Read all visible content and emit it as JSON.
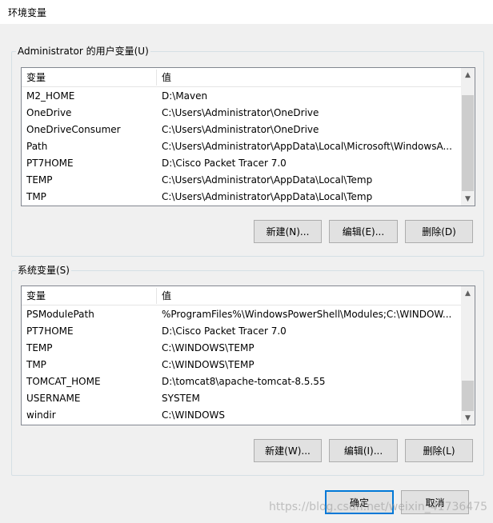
{
  "window": {
    "title": "环境变量"
  },
  "user_vars": {
    "group_label": "Administrator 的用户变量(U)",
    "col_name": "变量",
    "col_value": "值",
    "rows": [
      {
        "name": "M2_HOME",
        "value": "D:\\Maven"
      },
      {
        "name": "OneDrive",
        "value": "C:\\Users\\Administrator\\OneDrive"
      },
      {
        "name": "OneDriveConsumer",
        "value": "C:\\Users\\Administrator\\OneDrive"
      },
      {
        "name": "Path",
        "value": "C:\\Users\\Administrator\\AppData\\Local\\Microsoft\\WindowsA..."
      },
      {
        "name": "PT7HOME",
        "value": "D:\\Cisco Packet Tracer 7.0"
      },
      {
        "name": "TEMP",
        "value": "C:\\Users\\Administrator\\AppData\\Local\\Temp"
      },
      {
        "name": "TMP",
        "value": "C:\\Users\\Administrator\\AppData\\Local\\Temp"
      }
    ],
    "new_label": "新建(N)...",
    "edit_label": "编辑(E)...",
    "delete_label": "删除(D)"
  },
  "system_vars": {
    "group_label": "系统变量(S)",
    "col_name": "变量",
    "col_value": "值",
    "rows": [
      {
        "name": "PSModulePath",
        "value": "%ProgramFiles%\\WindowsPowerShell\\Modules;C:\\WINDOW..."
      },
      {
        "name": "PT7HOME",
        "value": "D:\\Cisco Packet Tracer 7.0"
      },
      {
        "name": "TEMP",
        "value": "C:\\WINDOWS\\TEMP"
      },
      {
        "name": "TMP",
        "value": "C:\\WINDOWS\\TEMP"
      },
      {
        "name": "TOMCAT_HOME",
        "value": "D:\\tomcat8\\apache-tomcat-8.5.55"
      },
      {
        "name": "USERNAME",
        "value": "SYSTEM"
      },
      {
        "name": "windir",
        "value": "C:\\WINDOWS"
      }
    ],
    "new_label": "新建(W)...",
    "edit_label": "编辑(I)...",
    "delete_label": "删除(L)"
  },
  "footer": {
    "ok_label": "确定",
    "cancel_label": "取消"
  },
  "watermark": "https://blog.csdn.net/weixin_41736475",
  "icons": {
    "scroll_up": "up-arrow-icon",
    "scroll_down": "down-arrow-icon"
  },
  "colors": {
    "accent": "#0078d7",
    "button_bg": "#e1e1e1",
    "window_bg": "#f0f0f0"
  }
}
